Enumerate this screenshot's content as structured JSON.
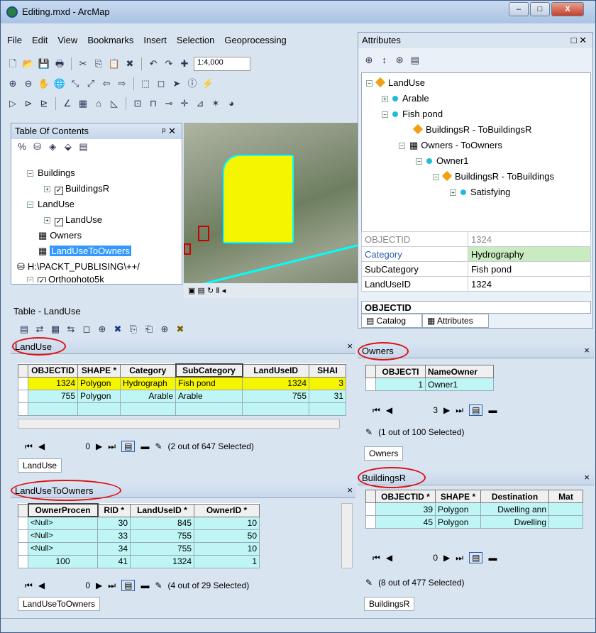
{
  "window": {
    "title": "Editing.mxd - ArcMap",
    "min": "–",
    "max": "□",
    "close": "X"
  },
  "menu": [
    "File",
    "Edit",
    "View",
    "Bookmarks",
    "Insert",
    "Selection",
    "Geoprocessing"
  ],
  "toolbar": {
    "scale": "1:4,000"
  },
  "toc": {
    "title": "Table Of Contents",
    "pin": "ᵖ ✕",
    "items": [
      "Buildings",
      "BuildingsR",
      "LandUse",
      "LandUse",
      "Owners",
      "LandUseToOwners",
      "H:\\PACKT_PUBLISING\\++/",
      "Orthophoto5k"
    ]
  },
  "attributes": {
    "title": "Attributes",
    "tree": [
      "LandUse",
      "Arable",
      "Fish pond",
      "BuildingsR - ToBuildingsR",
      "Owners - ToOwners",
      "Owner1",
      "BuildingsR - ToBuildings",
      "Satisfying"
    ],
    "props": [
      {
        "k": "OBJECTID",
        "v": "1324"
      },
      {
        "k": "Category",
        "v": "Hydrography"
      },
      {
        "k": "SubCategory",
        "v": "Fish pond"
      },
      {
        "k": "LandUseID",
        "v": "1324"
      }
    ],
    "footer": "OBJECTID",
    "tabs": [
      "Catalog",
      "Attributes"
    ]
  },
  "table_window": {
    "title": "Table - LandUse"
  },
  "landuse": {
    "title": "LandUse",
    "columns": [
      "OBJECTID",
      "SHAPE *",
      "Category",
      "SubCategory",
      "LandUseID",
      "SHAI"
    ],
    "rows": [
      [
        "1324",
        "Polygon",
        "Hydrograph",
        "Fish pond",
        "1324",
        "3"
      ],
      [
        "755",
        "Polygon",
        "Arable",
        "Arable",
        "755",
        "31"
      ]
    ],
    "record": "0",
    "selected": "(2 out of 647 Selected)",
    "tab": "LandUse"
  },
  "owners": {
    "title": "Owners",
    "columns": [
      "OBJECTI",
      "NameOwner"
    ],
    "rows": [
      [
        "1",
        "Owner1"
      ]
    ],
    "record": "3",
    "selected": "(1 out of 100 Selected)",
    "tab": "Owners"
  },
  "landusetoowners": {
    "title": "LandUseToOwners",
    "columns": [
      "OwnerProcen",
      "RID *",
      "LandUseID *",
      "OwnerID *"
    ],
    "rows": [
      [
        "<Null>",
        "30",
        "845",
        "10"
      ],
      [
        "<Null>",
        "33",
        "755",
        "50"
      ],
      [
        "<Null>",
        "34",
        "755",
        "10"
      ],
      [
        "100",
        "41",
        "1324",
        "1"
      ]
    ],
    "record": "0",
    "selected": "(4 out of 29 Selected)",
    "tab": "LandUseToOwners"
  },
  "buildingsr": {
    "title": "BuildingsR",
    "columns": [
      "OBJECTID *",
      "SHAPE *",
      "Destination",
      "Mat"
    ],
    "rows": [
      [
        "39",
        "Polygon",
        "Dwelling ann"
      ],
      [
        "45",
        "Polygon",
        "Dwelling"
      ]
    ],
    "record": "0",
    "selected": "(8 out of 477 Selected)",
    "tab": "BuildingsR"
  },
  "close_x": "×",
  "accent": {
    "cyan": "#bff5f5",
    "yellow": "#f5f500",
    "oval": "#e01010"
  }
}
